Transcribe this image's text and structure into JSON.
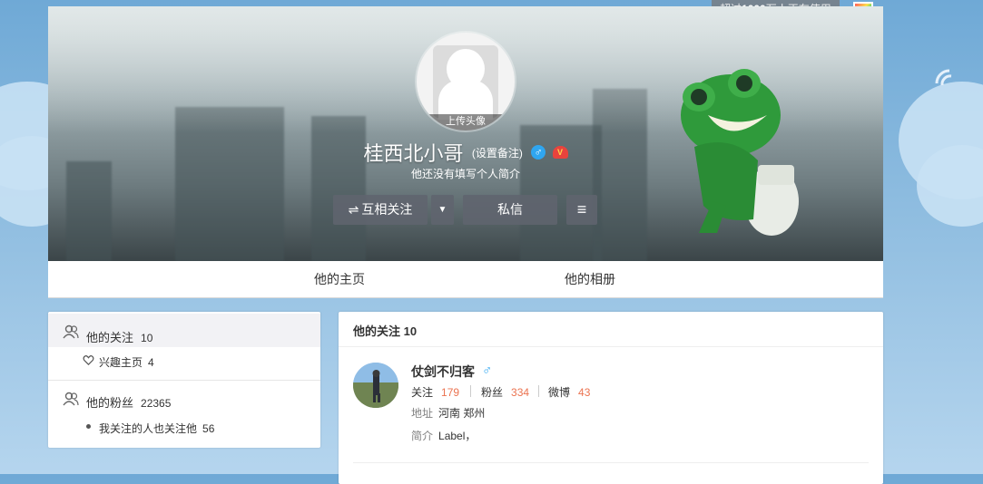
{
  "promo": {
    "prefix": "超过",
    "count": "1000",
    "suffix": "万人正在使用"
  },
  "profile": {
    "upload_label": "上传头像",
    "name": "桂西北小哥",
    "remark_label": "(设置备注)",
    "gender_symbol": "♂",
    "vip_label": "V",
    "bio": "他还没有填写个人简介",
    "follow_button": "互相关注",
    "follow_icon": "⇌",
    "dropdown_icon": "▼",
    "message_button": "私信",
    "menu_icon": "≡"
  },
  "tabs": [
    "他的主页",
    "他的相册"
  ],
  "sidebar": {
    "follow": {
      "label": "他的关注",
      "count": "10"
    },
    "interest": {
      "label": "兴趣主页",
      "count": "4"
    },
    "fans": {
      "label": "他的粉丝",
      "count": "22365"
    },
    "mutual": {
      "label": "我关注的人也关注他",
      "count": "56"
    }
  },
  "main": {
    "title": "他的关注 10",
    "user": {
      "name": "仗剑不归客",
      "gender_symbol": "♂",
      "follow_label": "关注",
      "follow_count": "179",
      "fans_label": "粉丝",
      "fans_count": "334",
      "weibo_label": "微博",
      "weibo_count": "43",
      "address_label": "地址",
      "address": "河南 郑州",
      "intro_label": "简介",
      "intro": "Label，"
    }
  },
  "colors": {
    "accent_orange": "#eb7350",
    "male_blue": "#2fa6f0",
    "button_gray": "#60646e"
  }
}
